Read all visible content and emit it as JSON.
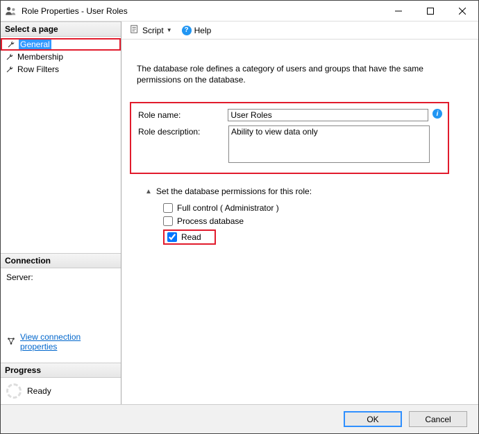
{
  "window": {
    "title": "Role Properties - User Roles"
  },
  "sidebar": {
    "selectPageHeader": "Select a page",
    "pages": [
      {
        "label": "General"
      },
      {
        "label": "Membership"
      },
      {
        "label": "Row Filters"
      }
    ],
    "connectionHeader": "Connection",
    "serverLabel": "Server:",
    "viewConnProps": "View connection properties",
    "progressHeader": "Progress",
    "progressStatus": "Ready"
  },
  "toolbar": {
    "script": "Script",
    "help": "Help"
  },
  "content": {
    "description": "The database role defines a category of users and groups that have the same permissions on the database.",
    "roleNameLabel": "Role name:",
    "roleNameValue": "User Roles",
    "roleDescLabel": "Role description:",
    "roleDescValue": "Ability to view data only",
    "permCaption": "Set the database permissions for this role:",
    "perms": {
      "fullControl": "Full control ( Administrator )",
      "processDb": "Process database",
      "read": "Read"
    }
  },
  "footer": {
    "ok": "OK",
    "cancel": "Cancel"
  }
}
